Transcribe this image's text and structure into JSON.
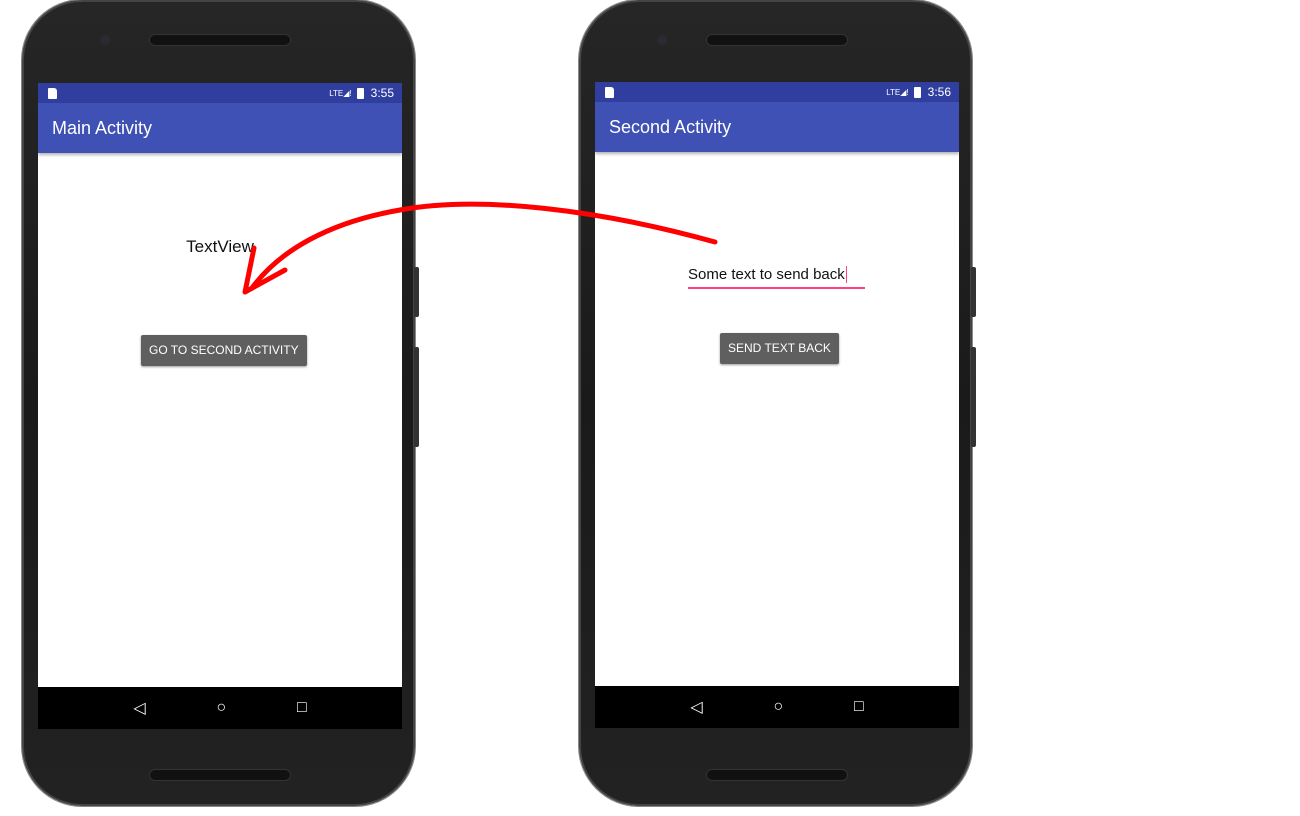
{
  "phones": [
    {
      "status_time": "3:55",
      "title": "Main Activity",
      "textview": "TextView",
      "button": "GO TO SECOND ACTIVITY"
    },
    {
      "status_time": "3:56",
      "title": "Second Activity",
      "edit_value": "Some text to send back",
      "button": "SEND TEXT BACK"
    }
  ],
  "status_icons": [
    "sd-card-icon",
    "lte-signal-icon",
    "battery-icon"
  ],
  "nav_icons": [
    "back-icon",
    "home-icon",
    "recents-icon"
  ],
  "colors": {
    "status_bar": "#303f9f",
    "app_bar": "#3f51b5",
    "accent": "#ff4081",
    "arrow": "#ff0000",
    "button": "#5f5f5f"
  }
}
